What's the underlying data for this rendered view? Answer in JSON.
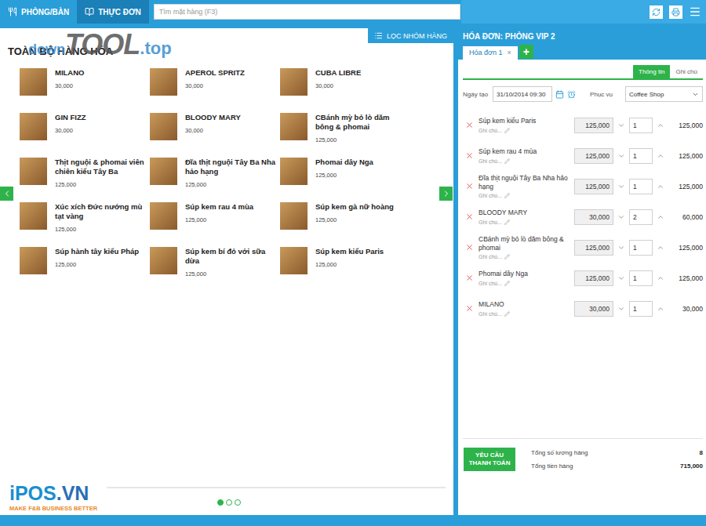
{
  "topbar": {
    "tabs": [
      {
        "label": "PHÒNG/BÀN",
        "selected": false
      },
      {
        "label": "THỰC ĐƠN",
        "selected": true
      }
    ],
    "search": {
      "placeholder": "Tìm mặt hàng (F3)"
    }
  },
  "watermark": {
    "parts": [
      "down",
      "TOOL",
      ".top"
    ]
  },
  "menu": {
    "title": "TOÀN BỘ HÀNG HÓA",
    "filter_button": "LỌC NHÓM HÀNG",
    "items": [
      {
        "name": "MILANO",
        "price": "30,000"
      },
      {
        "name": "APEROL SPRITZ",
        "price": "30,000"
      },
      {
        "name": "CUBA LIBRE",
        "price": "30,000"
      },
      {
        "name": "GIN FIZZ",
        "price": "30,000"
      },
      {
        "name": "BLOODY MARY",
        "price": "30,000"
      },
      {
        "name": "CBánh mỳ bỏ lò dăm bông & phomai",
        "price": "125,000"
      },
      {
        "name": "Thịt nguội & phomai viên chiên kiểu Tây Ba",
        "price": "125,000"
      },
      {
        "name": "Đĩa thịt nguội Tây Ba Nha hảo hạng",
        "price": "125,000"
      },
      {
        "name": "Phomai dây Nga",
        "price": "125,000"
      },
      {
        "name": "Xúc xích Đức nướng mù tạt vàng",
        "price": "125,000"
      },
      {
        "name": "Súp kem rau 4 mùa",
        "price": "125,000"
      },
      {
        "name": "Súp kem gà nữ hoàng",
        "price": "125,000"
      },
      {
        "name": "Súp hành tây kiểu Pháp",
        "price": "125,000"
      },
      {
        "name": "Súp kem bí đỏ với sữa dừa",
        "price": "125,000"
      },
      {
        "name": "Súp kem kiểu Paris",
        "price": "125,000"
      }
    ],
    "pages": [
      {
        "selected": true
      },
      {
        "selected": false
      },
      {
        "selected": false
      }
    ]
  },
  "logo": {
    "parts": [
      "iPOS",
      ".VN"
    ],
    "tagline": "MAKE F&B BUSINESS BETTER"
  },
  "invoice": {
    "title": "HÓA ĐƠN: PHÒNG VIP 2",
    "tabs": [
      {
        "label": "Hóa đơn 1",
        "close": "×",
        "selected": true
      }
    ],
    "add_button": "+",
    "panel_tabs": [
      {
        "label": "Thông tin",
        "selected": true
      },
      {
        "label": "Ghi chú",
        "selected": false
      }
    ],
    "date_label": "Ngày tạo",
    "date_value": "31/10/2014 09:30",
    "serve_label": "Phục vụ",
    "serve_value": "Coffee Shop",
    "lines": [
      {
        "name": "Súp kem kiểu Paris",
        "note": "Ghi chú...",
        "price": "125,000",
        "qty": "1",
        "total": "125,000"
      },
      {
        "name": "Súp kem rau 4 mùa",
        "note": "Ghi chú...",
        "price": "125,000",
        "qty": "1",
        "total": "125,000"
      },
      {
        "name": "Đĩa thịt nguội Tây Ba Nha hảo hạng",
        "note": "Ghi chú...",
        "price": "125,000",
        "qty": "1",
        "total": "125,000"
      },
      {
        "name": "BLOODY MARY",
        "note": "Ghi chú...",
        "price": "30,000",
        "qty": "2",
        "total": "60,000"
      },
      {
        "name": "CBánh mỳ bỏ lò dăm bông & phomai",
        "note": "Ghi chú...",
        "price": "125,000",
        "qty": "1",
        "total": "125,000"
      },
      {
        "name": "Phomai dây Nga",
        "note": "Ghi chú...",
        "price": "125,000",
        "qty": "1",
        "total": "125,000"
      },
      {
        "name": "MILANO",
        "note": "Ghi chú...",
        "price": "30,000",
        "qty": "1",
        "total": "30,000"
      }
    ],
    "pay_button": "YÊU CẦU THANH TOÁN",
    "totals": [
      {
        "label": "Tổng số lượng hàng",
        "value": "8"
      },
      {
        "label": "Tổng tiền hàng",
        "value": "715,000"
      }
    ]
  }
}
